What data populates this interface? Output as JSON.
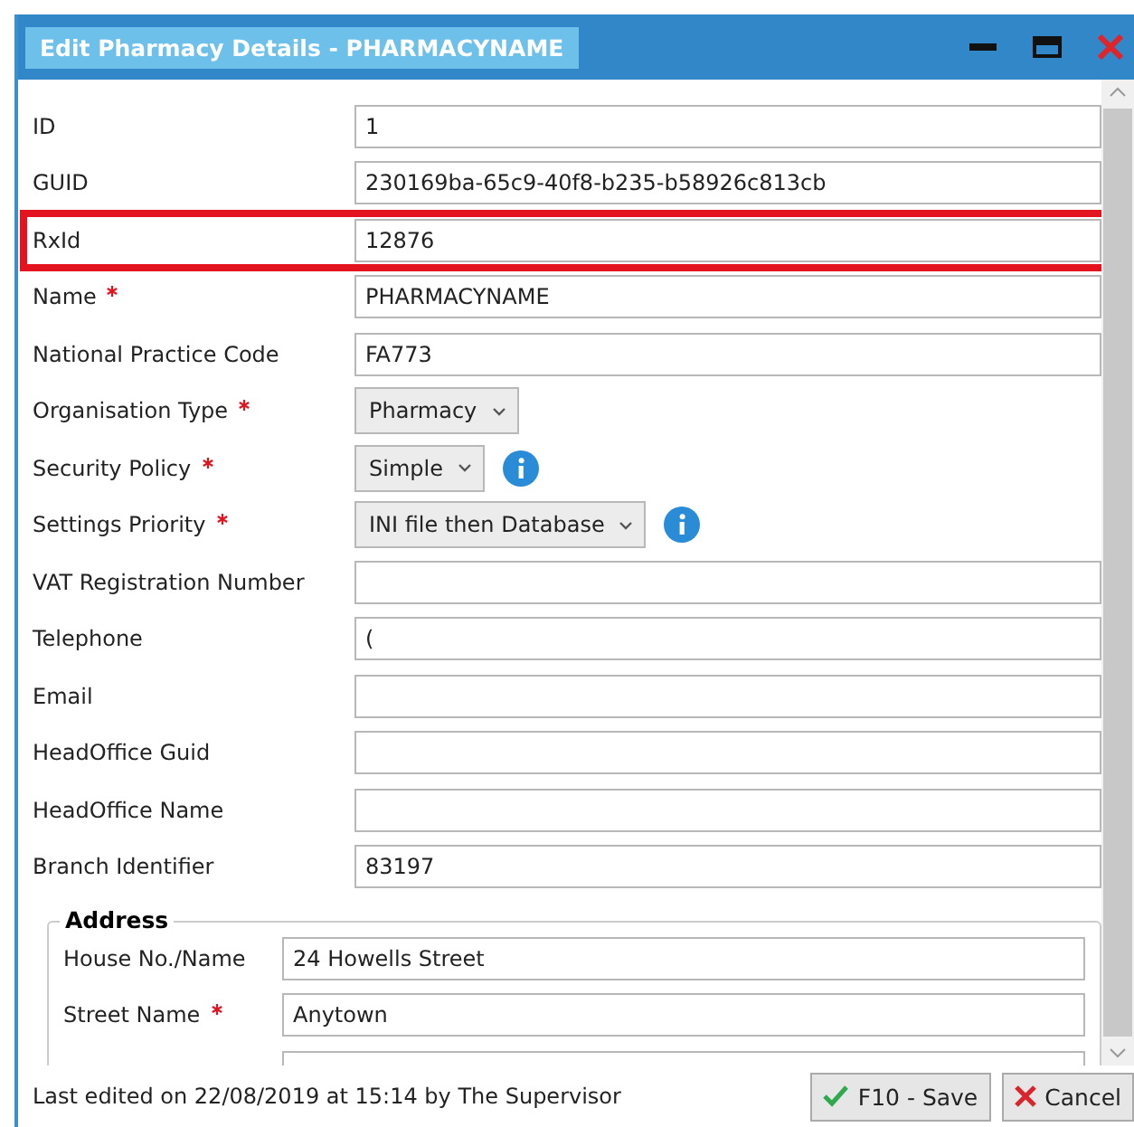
{
  "window": {
    "title": "Edit Pharmacy Details - PHARMACYNAME"
  },
  "fields": [
    {
      "kind": "text",
      "label": "ID",
      "value": "1",
      "required": false,
      "highlighted": false
    },
    {
      "kind": "text",
      "label": "GUID",
      "value": "230169ba-65c9-40f8-b235-b58926c813cb",
      "required": false,
      "highlighted": false
    },
    {
      "kind": "text",
      "label": "RxId",
      "value": "12876",
      "required": false,
      "highlighted": true
    },
    {
      "kind": "text",
      "label": "Name",
      "value": "PHARMACYNAME",
      "required": true,
      "highlighted": false
    },
    {
      "kind": "text",
      "label": "National Practice Code",
      "value": "FA773",
      "required": false,
      "highlighted": false
    },
    {
      "kind": "select",
      "label": "Organisation Type",
      "value": "Pharmacy",
      "required": true,
      "highlighted": false,
      "info": false
    },
    {
      "kind": "select",
      "label": "Security Policy",
      "value": "Simple",
      "required": true,
      "highlighted": false,
      "info": true
    },
    {
      "kind": "select",
      "label": "Settings Priority",
      "value": "INI file then Database",
      "required": true,
      "highlighted": false,
      "info": true
    },
    {
      "kind": "text",
      "label": "VAT Registration Number",
      "required": false,
      "highlighted": false
    },
    {
      "kind": "text",
      "label": "Telephone",
      "value": "(",
      "required": false,
      "highlighted": false
    },
    {
      "kind": "text",
      "label": "Email",
      "required": false,
      "highlighted": false
    },
    {
      "kind": "text",
      "label": "HeadOffice Guid",
      "required": false,
      "highlighted": false
    },
    {
      "kind": "text",
      "label": "HeadOffice Name",
      "required": false,
      "highlighted": false
    },
    {
      "kind": "text",
      "label": "Branch Identifier",
      "value": "83197",
      "required": false,
      "highlighted": false
    }
  ],
  "address": {
    "title": "Address",
    "fields": [
      {
        "label": "House No./Name",
        "value": "24 Howells Street",
        "required": false
      },
      {
        "label": "Street Name",
        "value": "Anytown",
        "required": true
      }
    ]
  },
  "status_bar": {
    "text": "Last edited on 22/08/2019 at 15:14 by The Supervisor"
  },
  "buttons": [
    {
      "kind": "save",
      "label": "F10 - Save"
    },
    {
      "kind": "cancel",
      "label": "Cancel"
    }
  ]
}
